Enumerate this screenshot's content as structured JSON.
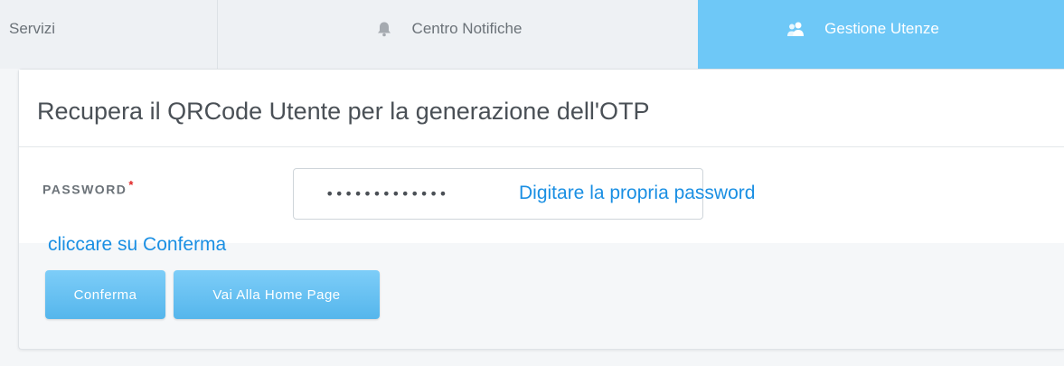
{
  "tabs": {
    "servizi": {
      "label": "Servizi"
    },
    "notifiche": {
      "label": "Centro Notifiche",
      "icon": "bell-icon"
    },
    "utenze": {
      "label": "Gestione Utenze",
      "icon": "users-icon",
      "active": true
    }
  },
  "form": {
    "title": "Recupera il QRCode Utente per la generazione dell'OTP",
    "password_label": "PASSWORD",
    "required_mark": "*",
    "password_value": "•••••••••••••",
    "hint_password": "Digitare la propria password",
    "hint_confirm": "cliccare su Conferma",
    "confirm_label": "Conferma",
    "home_label": "Vai Alla Home Page"
  },
  "colors": {
    "active_tab": "#6ec8f7",
    "button": "#5cbcf0",
    "annotation": "#1a8fe3",
    "required": "#e02424"
  }
}
